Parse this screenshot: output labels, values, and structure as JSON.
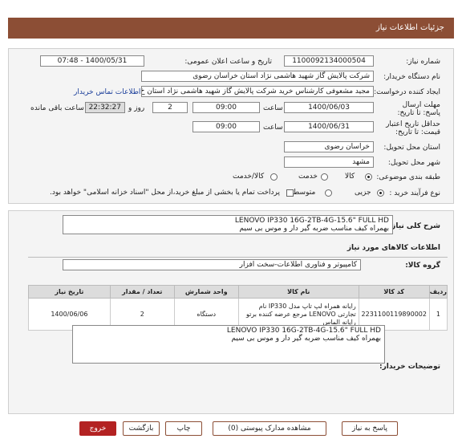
{
  "header": {
    "title": "جزئیات اطلاعات نیاز"
  },
  "form": {
    "need_number_label": "شماره نیاز:",
    "need_number": "1100092134000504",
    "announce_label": "تاریخ و ساعت اعلان عمومی:",
    "announce_value": "1400/05/31 - 07:48",
    "buyer_label": "نام دستگاه خریدار:",
    "buyer_value": "شرکت پالایش گاز شهید هاشمی نژاد   استان خراسان رضوی",
    "creator_label": "ایجاد کننده درخواست:",
    "creator_value": "مجید مشعوفی کارشناس خرید شرکت پالایش گاز شهید هاشمی نژاد   استان خ",
    "contact_link": "اطلاعات تماس خریدار",
    "deadline_label": "مهلت ارسال پاسخ: تا تاریخ:",
    "deadline_date": "1400/06/03",
    "time_label": "ساعت",
    "deadline_time": "09:00",
    "days_value": "2",
    "days_label": "روز و",
    "remaining_time": "22:32:27",
    "remaining_label": "ساعت باقی مانده",
    "validity_label": "حداقل تاریخ اعتبار قیمت: تا تاریخ:",
    "validity_date": "1400/06/31",
    "validity_time_label": "ساعت",
    "validity_time": "09:00",
    "province_label": "استان محل تحویل:",
    "province_value": "خراسان رضوی",
    "city_label": "شهر محل تحویل:",
    "city_value": "مشهد",
    "category_label": "طبقه بندی موضوعی:",
    "category_options": [
      "کالا",
      "خدمت",
      "کالا/خدمت"
    ],
    "process_label": "نوع فرآیند خرید :",
    "process_options": [
      "جزیی",
      "متوسط"
    ],
    "payment_note": "پرداخت تمام یا بخشی از مبلغ خرید،از محل \"اسناد خزانه اسلامی\" خواهد بود."
  },
  "summary": {
    "label": "شرح کلی نیاز:",
    "line1": "LENOVO IP330 16G-2TB-4G-15.6\" FULL HD",
    "line2": "بهمراه کیف مناسب  ضربه گیر دار و موس بی سیم"
  },
  "goods": {
    "section_title": "اطلاعات کالاهای مورد نیاز",
    "group_label": "گروه کالا:",
    "group_value": "کامپیوتر و فناوری اطلاعات-سخت افزار",
    "columns": [
      "ردیف",
      "کد کالا",
      "نام کالا",
      "واحد شمارش",
      "تعداد / مقدار",
      "تاریخ نیاز"
    ],
    "rows": [
      {
        "row": "1",
        "code": "2231100119890002",
        "name": "رایانه همراه لپ تاپ مدل IP330 نام تجارتی LENOVO مرجع عرضه کننده برتو رایانه الماس",
        "unit": "دستگاه",
        "qty": "2",
        "date": "1400/06/06"
      }
    ]
  },
  "buyer_notes": {
    "label": "توضیحات خریدار:",
    "line1": "LENOVO IP330 16G-2TB-4G-15.6\" FULL HD",
    "line2": "بهمراه کیف مناسب  ضربه گیر دار و موس بی سیم"
  },
  "buttons": {
    "reply": "پاسخ به نیاز",
    "docs": "مشاهده مدارک پیوستی (0)",
    "print": "چاپ",
    "back": "بازگشت",
    "exit": "خروج"
  }
}
